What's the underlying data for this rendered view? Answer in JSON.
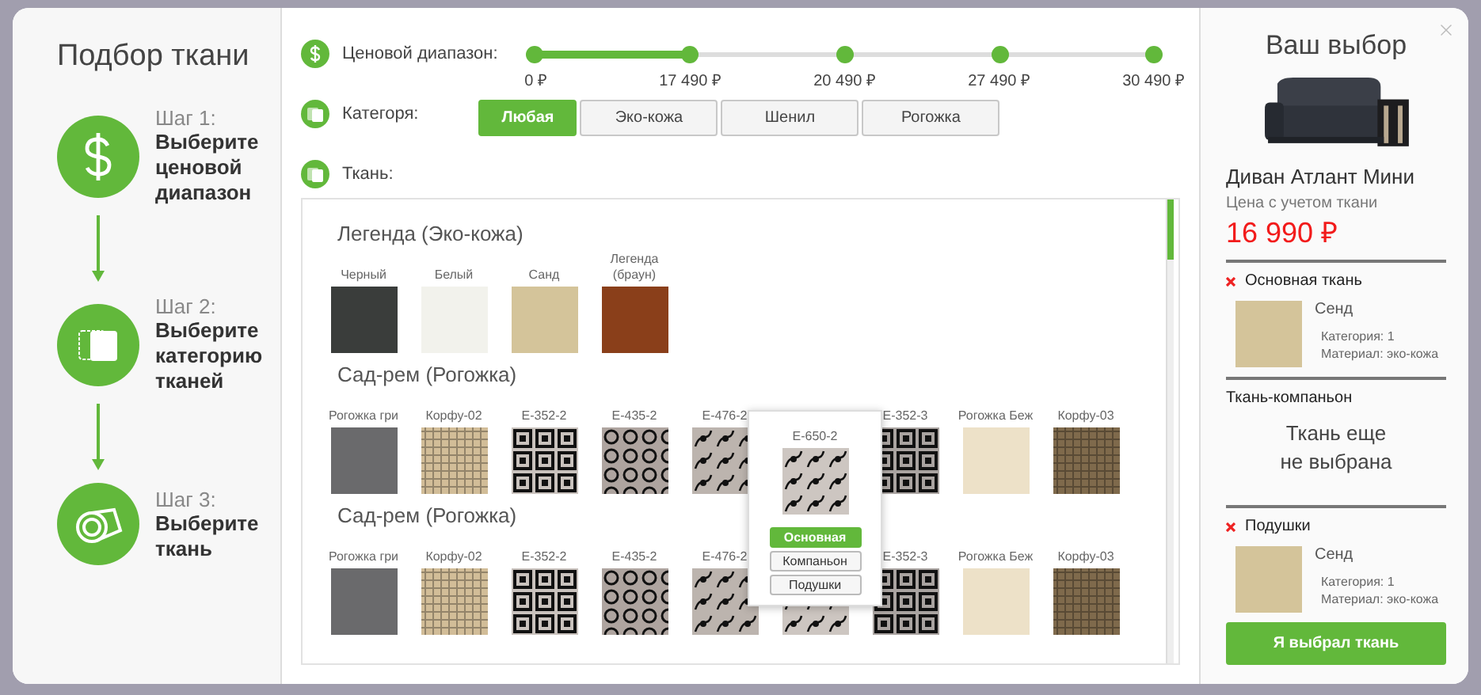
{
  "left_panel": {
    "title": "Подбор ткани",
    "steps": [
      {
        "step": "Шаг 1:",
        "title": "Выберите ценовой диапазон",
        "kind": "price"
      },
      {
        "step": "Шаг 2:",
        "title": "Выберите категорию тканей",
        "kind": "category"
      },
      {
        "step": "Шаг 3:",
        "title": "Выберите ткань",
        "kind": "fabric"
      }
    ]
  },
  "filters": {
    "price": {
      "label": "Ценовой диапазон:",
      "level": 0.25,
      "stops": [
        "0 ₽",
        "17 490 ₽",
        "20 490 ₽",
        "27 490 ₽",
        "30 490 ₽"
      ]
    },
    "category": {
      "label": "Категоря:",
      "options": [
        {
          "label": "Любая",
          "selected": true
        },
        {
          "label": "Эко-кожа",
          "selected": false
        },
        {
          "label": "Шенил",
          "selected": false
        },
        {
          "label": "Рогожка",
          "selected": false
        }
      ]
    },
    "fabric_label": "Ткань:"
  },
  "collections": [
    {
      "title": "Легенда (Эко-кожа)",
      "fabrics": [
        {
          "label": "Черный",
          "color": "#3a3d3b",
          "kind": "plain"
        },
        {
          "label": "Белый",
          "color": "#f2f2ec",
          "kind": "plain"
        },
        {
          "label": "Санд",
          "color": "#d4c49a",
          "kind": "plain"
        },
        {
          "label": "Легенда (браун)",
          "color": "#8a3f1a",
          "kind": "plain"
        }
      ]
    },
    {
      "title": "Сад-рем (Рогожка)",
      "fabrics": [
        {
          "label": "Рогожка гри",
          "color": "#6a6a6c",
          "kind": "plain"
        },
        {
          "label": "Корфу-02",
          "color": "#d2bd98",
          "kind": "weave"
        },
        {
          "label": "E-352-2",
          "color": "#c9c2bd",
          "kind": "squares"
        },
        {
          "label": "E-435-2",
          "color": "#aea49f",
          "kind": "circles"
        },
        {
          "label": "E-476-2",
          "color": "#bcb4ae",
          "kind": "floral"
        },
        {
          "label": "E-650-2",
          "color": "#cdc6c1",
          "kind": "floral",
          "popup": {
            "buttons": [
              {
                "label": "Основная",
                "selected": true
              },
              {
                "label": "Компаньон",
                "selected": false
              },
              {
                "label": "Подушки",
                "selected": false
              }
            ]
          }
        },
        {
          "label": "E-352-3",
          "color": "#a9a3a0",
          "kind": "squares"
        },
        {
          "label": "Рогожка Беж",
          "color": "#ede1c8",
          "kind": "plain"
        },
        {
          "label": "Корфу-03",
          "color": "#7f6a4c",
          "kind": "weave"
        }
      ]
    },
    {
      "title": "Сад-рем (Рогожка)",
      "fabrics": [
        {
          "label": "Рогожка гри",
          "color": "#6a6a6c",
          "kind": "plain"
        },
        {
          "label": "Корфу-02",
          "color": "#d2bd98",
          "kind": "weave"
        },
        {
          "label": "E-352-2",
          "color": "#c9c2bd",
          "kind": "squares"
        },
        {
          "label": "E-435-2",
          "color": "#aea49f",
          "kind": "circles"
        },
        {
          "label": "E-476-2",
          "color": "#bcb4ae",
          "kind": "floral"
        },
        {
          "color": "#cdc6c1",
          "kind": "floral"
        },
        {
          "label": "E-352-3",
          "color": "#a9a3a0",
          "kind": "squares"
        },
        {
          "label": "Рогожка Беж",
          "color": "#ede1c8",
          "kind": "plain"
        },
        {
          "label": "Корфу-03",
          "color": "#7f6a4c",
          "kind": "weave"
        }
      ]
    }
  ],
  "selection": {
    "title": "Ваш выбор",
    "product": "Диван Атлант Мини",
    "price_caption": "Цена с учетом ткани",
    "price": "16 990 ₽",
    "sections": [
      {
        "title": "Основная ткань",
        "removable": true,
        "fabric": {
          "name": "Сенд",
          "color": "#d4c49a",
          "category": "Категория: 1",
          "material": "Материал: эко-кожа"
        }
      },
      {
        "title": "Ткань-компаньон",
        "removable": false,
        "empty": "Ткань еще\nне выбрана"
      },
      {
        "title": "Подушки",
        "removable": true,
        "fabric": {
          "name": "Сенд",
          "color": "#d4c49a",
          "category": "Категория: 1",
          "material": "Материал: эко-кожа"
        }
      }
    ],
    "button": "Я выбрал ткань"
  }
}
